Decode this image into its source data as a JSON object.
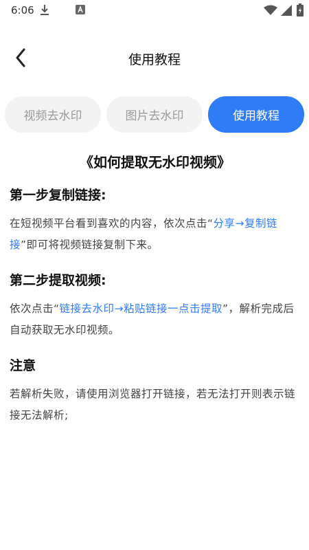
{
  "status": {
    "time": "6:06",
    "icons": [
      "download-icon",
      "a-notification-icon",
      "wifi-icon",
      "signal-icon",
      "battery-icon"
    ]
  },
  "nav": {
    "title": "使用教程",
    "back_icon": "chevron-left-icon"
  },
  "tabs": [
    {
      "label": "视频去水印",
      "active": false
    },
    {
      "label": "图片去水印",
      "active": false
    },
    {
      "label": "使用教程",
      "active": true
    }
  ],
  "colors": {
    "accent": "#2f7cf6",
    "inactive_tab_bg": "#f3f3f3",
    "inactive_tab_text": "#9a9a9a"
  },
  "content": {
    "title": "《如何提取无水印视频》",
    "step1": {
      "heading": "第一步复制链接:",
      "text_before": "在短视频平台看到喜欢的内容，依次点击“",
      "link": "分享→复制链接",
      "text_after": "”即可将视频链接复制下来。"
    },
    "step2": {
      "heading": "第二步提取视频:",
      "text_before": "依次点击“",
      "link": "链接去水印→粘贴链接一点击提取",
      "text_after": "”，解析完成后自动获取无水印视频。"
    },
    "note": {
      "heading": "注意",
      "text": "若解析失败，请使用浏览器打开链接，若无法打开则表示链接无法解析;"
    }
  }
}
